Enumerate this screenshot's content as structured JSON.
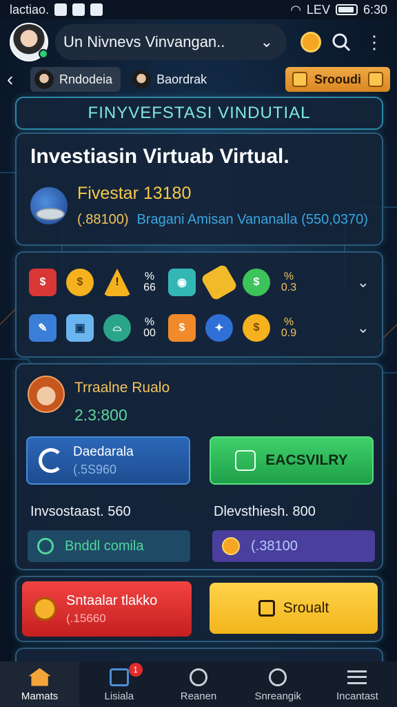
{
  "status_bar": {
    "left_text": "lactiao.",
    "time": "6:30",
    "carrier": "LEV"
  },
  "header": {
    "account_name": "Un Nivnevs Vinvangan..",
    "avatar": "user-avatar",
    "icons": [
      "coin-icon",
      "search-icon",
      "more-vertical-icon"
    ]
  },
  "profile_tabs": [
    {
      "label": "Rndodeia"
    },
    {
      "label": "Baordrak"
    }
  ],
  "special_button": {
    "label": "Srooudi"
  },
  "banner": {
    "title": "FINYVEFSTASI VINDUTIAL"
  },
  "investment": {
    "heading": "Investiasin Virtuab Virtual.",
    "name": "Fivestar 13180",
    "amount": "(.88100)",
    "detail": "Bragani Amisan Vananalla (550,0370)"
  },
  "icon_grid": {
    "rows": [
      [
        "chat-icon",
        "coin-icon",
        "warning-icon",
        "percent-icon",
        "cash-icon",
        "gold-bar-icon",
        "dollar-icon",
        "percent-icon"
      ],
      [
        "edit-icon",
        "cube-icon",
        "bubble-icon",
        "percent-icon",
        "box-dollar-icon",
        "coupon-icon",
        "coin-icon",
        "percent-icon"
      ]
    ],
    "percent_labels": [
      [
        "%",
        "66"
      ],
      [
        "%",
        "0.3"
      ],
      [
        "%",
        "00"
      ],
      [
        "%",
        "0.9"
      ]
    ]
  },
  "trade": {
    "title": "Trraalne Rualo",
    "amount": "2.3:800",
    "blue_box": {
      "title": "Daedarala",
      "sub": "(.5S960"
    },
    "green_box": {
      "label": "EACSVILRY"
    },
    "left_label": "Invsostaast. 560",
    "right_label": "Dlevsthiesh. 800",
    "teal_box": {
      "label": "Bnddl comila"
    },
    "purple_box": {
      "label": "(.38100"
    }
  },
  "actions": {
    "red": {
      "title": "Sntaalar tlakko",
      "sub": "(.15660"
    },
    "yellow": {
      "label": "Sroualt"
    }
  },
  "bottom_nav": [
    {
      "label": "Mamats",
      "icon": "home-icon",
      "active": true
    },
    {
      "label": "Lisiala",
      "icon": "calendar-icon",
      "badge": "1"
    },
    {
      "label": "Reanen",
      "icon": "search-icon"
    },
    {
      "label": "Snreangik",
      "icon": "search-icon"
    },
    {
      "label": "Incantast",
      "icon": "menu-icon"
    }
  ],
  "colors": {
    "accent": "#f3c45c",
    "teal": "#7fe8e0",
    "green": "#3fd06a",
    "red": "#e23030",
    "yellow": "#ffd34a"
  }
}
